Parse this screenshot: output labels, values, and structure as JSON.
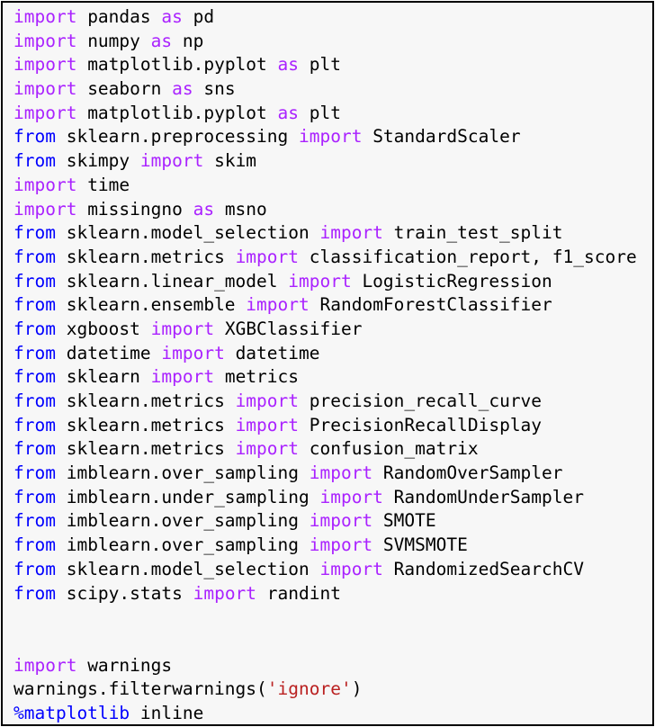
{
  "colors": {
    "keyword": "#aa22ff",
    "keyword_blue": "#0000ff",
    "magic": "#0000ff",
    "string": "#ba2121",
    "text": "#000000",
    "background": "#f7f7f7",
    "border": "#000000"
  },
  "code_lines": [
    [
      {
        "t": "import",
        "c": "kw"
      },
      {
        "t": " pandas ",
        "c": "name"
      },
      {
        "t": "as",
        "c": "kw"
      },
      {
        "t": " pd",
        "c": "name"
      }
    ],
    [
      {
        "t": "import",
        "c": "kw"
      },
      {
        "t": " numpy ",
        "c": "name"
      },
      {
        "t": "as",
        "c": "kw"
      },
      {
        "t": " np",
        "c": "name"
      }
    ],
    [
      {
        "t": "import",
        "c": "kw"
      },
      {
        "t": " matplotlib.pyplot ",
        "c": "name"
      },
      {
        "t": "as",
        "c": "kw"
      },
      {
        "t": " plt",
        "c": "name"
      }
    ],
    [
      {
        "t": "import",
        "c": "kw"
      },
      {
        "t": " seaborn ",
        "c": "name"
      },
      {
        "t": "as",
        "c": "kw"
      },
      {
        "t": " sns",
        "c": "name"
      }
    ],
    [
      {
        "t": "import",
        "c": "kw"
      },
      {
        "t": " matplotlib.pyplot ",
        "c": "name"
      },
      {
        "t": "as",
        "c": "kw"
      },
      {
        "t": " plt",
        "c": "name"
      }
    ],
    [
      {
        "t": "from",
        "c": "kwb"
      },
      {
        "t": " sklearn.preprocessing ",
        "c": "name"
      },
      {
        "t": "import",
        "c": "kw"
      },
      {
        "t": " StandardScaler",
        "c": "name"
      }
    ],
    [
      {
        "t": "from",
        "c": "kwb"
      },
      {
        "t": " skimpy ",
        "c": "name"
      },
      {
        "t": "import",
        "c": "kw"
      },
      {
        "t": " skim",
        "c": "name"
      }
    ],
    [
      {
        "t": "import",
        "c": "kw"
      },
      {
        "t": " time",
        "c": "name"
      }
    ],
    [
      {
        "t": "import",
        "c": "kw"
      },
      {
        "t": " missingno ",
        "c": "name"
      },
      {
        "t": "as",
        "c": "kw"
      },
      {
        "t": " msno",
        "c": "name"
      }
    ],
    [
      {
        "t": "from",
        "c": "kwb"
      },
      {
        "t": " sklearn.model_selection ",
        "c": "name"
      },
      {
        "t": "import",
        "c": "kw"
      },
      {
        "t": " train_test_split",
        "c": "name"
      }
    ],
    [
      {
        "t": "from",
        "c": "kwb"
      },
      {
        "t": " sklearn.metrics ",
        "c": "name"
      },
      {
        "t": "import",
        "c": "kw"
      },
      {
        "t": " classification_report, f1_score",
        "c": "name"
      }
    ],
    [
      {
        "t": "from",
        "c": "kwb"
      },
      {
        "t": " sklearn.linear_model ",
        "c": "name"
      },
      {
        "t": "import",
        "c": "kw"
      },
      {
        "t": " LogisticRegression",
        "c": "name"
      }
    ],
    [
      {
        "t": "from",
        "c": "kwb"
      },
      {
        "t": " sklearn.ensemble ",
        "c": "name"
      },
      {
        "t": "import",
        "c": "kw"
      },
      {
        "t": " RandomForestClassifier",
        "c": "name"
      }
    ],
    [
      {
        "t": "from",
        "c": "kwb"
      },
      {
        "t": " xgboost ",
        "c": "name"
      },
      {
        "t": "import",
        "c": "kw"
      },
      {
        "t": " XGBClassifier",
        "c": "name"
      }
    ],
    [
      {
        "t": "from",
        "c": "kwb"
      },
      {
        "t": " datetime ",
        "c": "name"
      },
      {
        "t": "import",
        "c": "kw"
      },
      {
        "t": " datetime",
        "c": "name"
      }
    ],
    [
      {
        "t": "from",
        "c": "kwb"
      },
      {
        "t": " sklearn ",
        "c": "name"
      },
      {
        "t": "import",
        "c": "kw"
      },
      {
        "t": " metrics",
        "c": "name"
      }
    ],
    [
      {
        "t": "from",
        "c": "kwb"
      },
      {
        "t": " sklearn.metrics ",
        "c": "name"
      },
      {
        "t": "import",
        "c": "kw"
      },
      {
        "t": " precision_recall_curve",
        "c": "name"
      }
    ],
    [
      {
        "t": "from",
        "c": "kwb"
      },
      {
        "t": " sklearn.metrics ",
        "c": "name"
      },
      {
        "t": "import",
        "c": "kw"
      },
      {
        "t": " PrecisionRecallDisplay",
        "c": "name"
      }
    ],
    [
      {
        "t": "from",
        "c": "kwb"
      },
      {
        "t": " sklearn.metrics ",
        "c": "name"
      },
      {
        "t": "import",
        "c": "kw"
      },
      {
        "t": " confusion_matrix",
        "c": "name"
      }
    ],
    [
      {
        "t": "from",
        "c": "kwb"
      },
      {
        "t": " imblearn.over_sampling ",
        "c": "name"
      },
      {
        "t": "import",
        "c": "kw"
      },
      {
        "t": " RandomOverSampler",
        "c": "name"
      }
    ],
    [
      {
        "t": "from",
        "c": "kwb"
      },
      {
        "t": " imblearn.under_sampling ",
        "c": "name"
      },
      {
        "t": "import",
        "c": "kw"
      },
      {
        "t": " RandomUnderSampler",
        "c": "name"
      }
    ],
    [
      {
        "t": "from",
        "c": "kwb"
      },
      {
        "t": " imblearn.over_sampling ",
        "c": "name"
      },
      {
        "t": "import",
        "c": "kw"
      },
      {
        "t": " SMOTE",
        "c": "name"
      }
    ],
    [
      {
        "t": "from",
        "c": "kwb"
      },
      {
        "t": " imblearn.over_sampling ",
        "c": "name"
      },
      {
        "t": "import",
        "c": "kw"
      },
      {
        "t": " SVMSMOTE",
        "c": "name"
      }
    ],
    [
      {
        "t": "from",
        "c": "kwb"
      },
      {
        "t": " sklearn.model_selection ",
        "c": "name"
      },
      {
        "t": "import",
        "c": "kw"
      },
      {
        "t": " RandomizedSearchCV",
        "c": "name"
      }
    ],
    [
      {
        "t": "from",
        "c": "kwb"
      },
      {
        "t": " scipy.stats ",
        "c": "name"
      },
      {
        "t": "import",
        "c": "kw"
      },
      {
        "t": " randint",
        "c": "name"
      }
    ],
    [],
    [],
    [
      {
        "t": "import",
        "c": "kw"
      },
      {
        "t": " warnings",
        "c": "name"
      }
    ],
    [
      {
        "t": "warnings.filterwarnings(",
        "c": "name"
      },
      {
        "t": "'ignore'",
        "c": "str"
      },
      {
        "t": ")",
        "c": "name"
      }
    ],
    [
      {
        "t": "%matplotlib",
        "c": "magic"
      },
      {
        "t": " inline",
        "c": "name"
      }
    ]
  ]
}
